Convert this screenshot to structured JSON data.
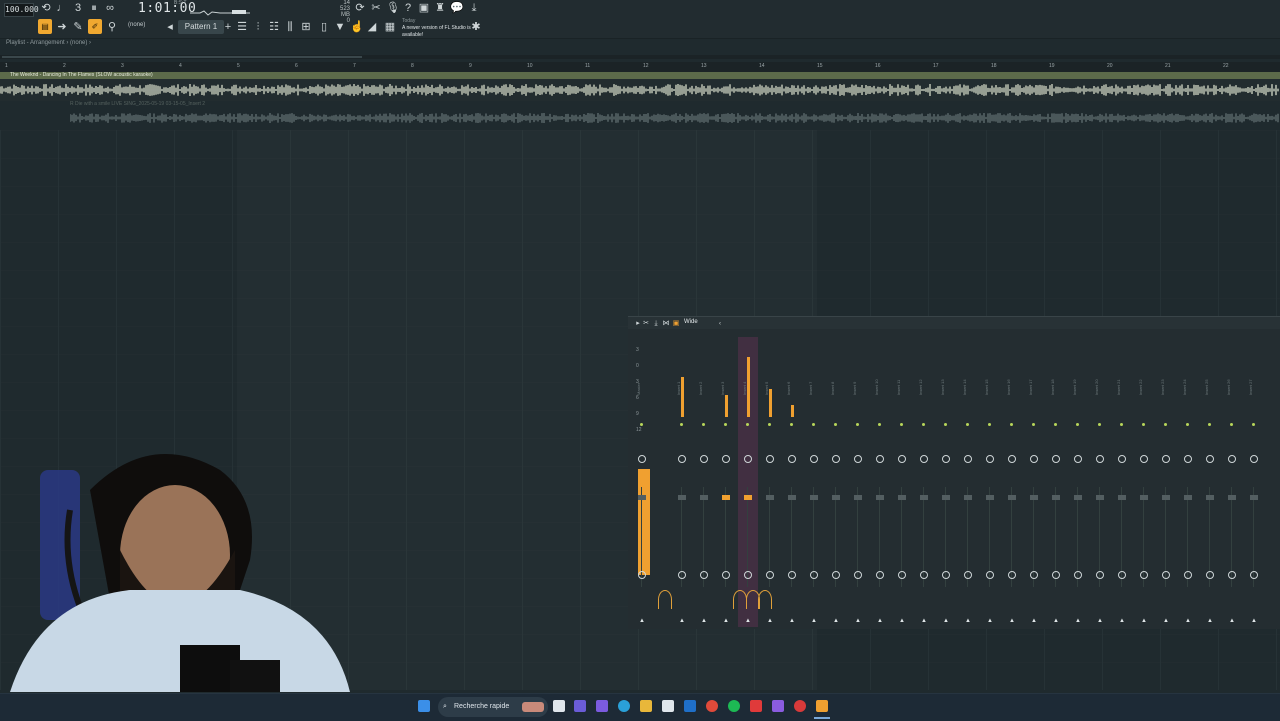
{
  "toolbar": {
    "tempo": "100.000",
    "time": "1:01:00",
    "time_sub": "B:S:T",
    "memory_top": "14",
    "memory_mb": "523 MB",
    "memory_bottom": "0",
    "pattern_label": "Pattern 1",
    "none_label": "(none)",
    "notice_today": "Today",
    "notice_text": "A newer version of FL Studio is available!"
  },
  "breadcrumb": "Playlist - Arrangement › (none) ›",
  "ruler": [
    "1",
    "2",
    "3",
    "4",
    "5",
    "6",
    "7",
    "8",
    "9",
    "10",
    "11",
    "12",
    "13",
    "14",
    "15",
    "16",
    "17",
    "18",
    "19",
    "20",
    "21",
    "22"
  ],
  "tracks": [
    {
      "title": "The Weeknd - Dancing In The Flames (SLOW acoustic karaoke)"
    },
    {
      "title": "R Die with a smile LIVE SING_2025-05-19 03-15-05_Insert 2"
    }
  ],
  "mixer": {
    "title": "Wide",
    "scale": [
      "3",
      "0",
      "3",
      "6",
      "9",
      "12"
    ],
    "channels": [
      "Master",
      "Insert 1",
      "Insert 2",
      "Insert 3",
      "Insert 4",
      "Insert 5",
      "Insert 6",
      "Insert 7",
      "Insert 8",
      "Insert 9",
      "Insert 10",
      "Insert 11",
      "Insert 12",
      "Insert 13",
      "Insert 14",
      "Insert 15",
      "Insert 16",
      "Insert 17",
      "Insert 18",
      "Insert 19",
      "Insert 20",
      "Insert 21",
      "Insert 22",
      "Insert 23",
      "Insert 24",
      "Insert 25",
      "Insert 26",
      "Insert 27"
    ]
  },
  "taskbar": {
    "search_placeholder": "Recherche rapide"
  },
  "colors": {
    "accent": "#f0a030",
    "background": "#1f2a2e",
    "selected_channel": "#c83c8c"
  }
}
